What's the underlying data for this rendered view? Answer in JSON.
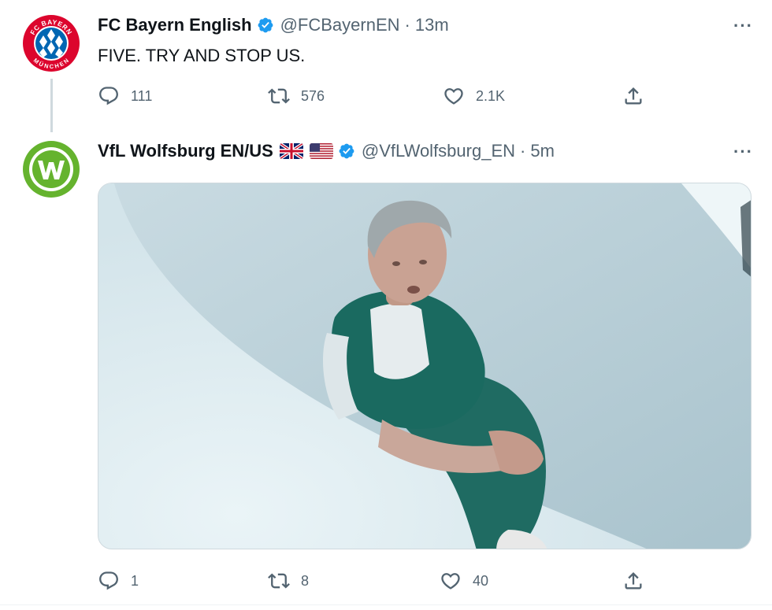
{
  "tweets": [
    {
      "display_name": "FC Bayern English",
      "handle": "@FCBayernEN",
      "separator": "·",
      "time": "13m",
      "text": "FIVE. TRY AND STOP US.",
      "avatar_icon": "fc-bayern-logo",
      "avatar_text_top": "FC BAYERN",
      "avatar_text_bottom": "MÜNCHEN",
      "more_label": "···",
      "actions": {
        "replies": "111",
        "retweets": "576",
        "likes": "2.1K"
      }
    },
    {
      "display_name": "VfL Wolfsburg EN/US",
      "flags": [
        "uk-flag-icon",
        "us-flag-icon"
      ],
      "handle": "@VfLWolfsburg_EN",
      "separator": "·",
      "time": "5m",
      "avatar_icon": "vfl-wolfsburg-logo",
      "media_icon": "embedded-gif-photo",
      "more_label": "···",
      "actions": {
        "replies": "1",
        "retweets": "8",
        "likes": "40"
      }
    }
  ],
  "colors": {
    "verified": "#1d9bf0",
    "text": "#0f1419",
    "secondary": "#536471",
    "bayern_red": "#dc052d",
    "bayern_blue": "#0066b2",
    "wolfsburg_green": "#65b32e"
  }
}
